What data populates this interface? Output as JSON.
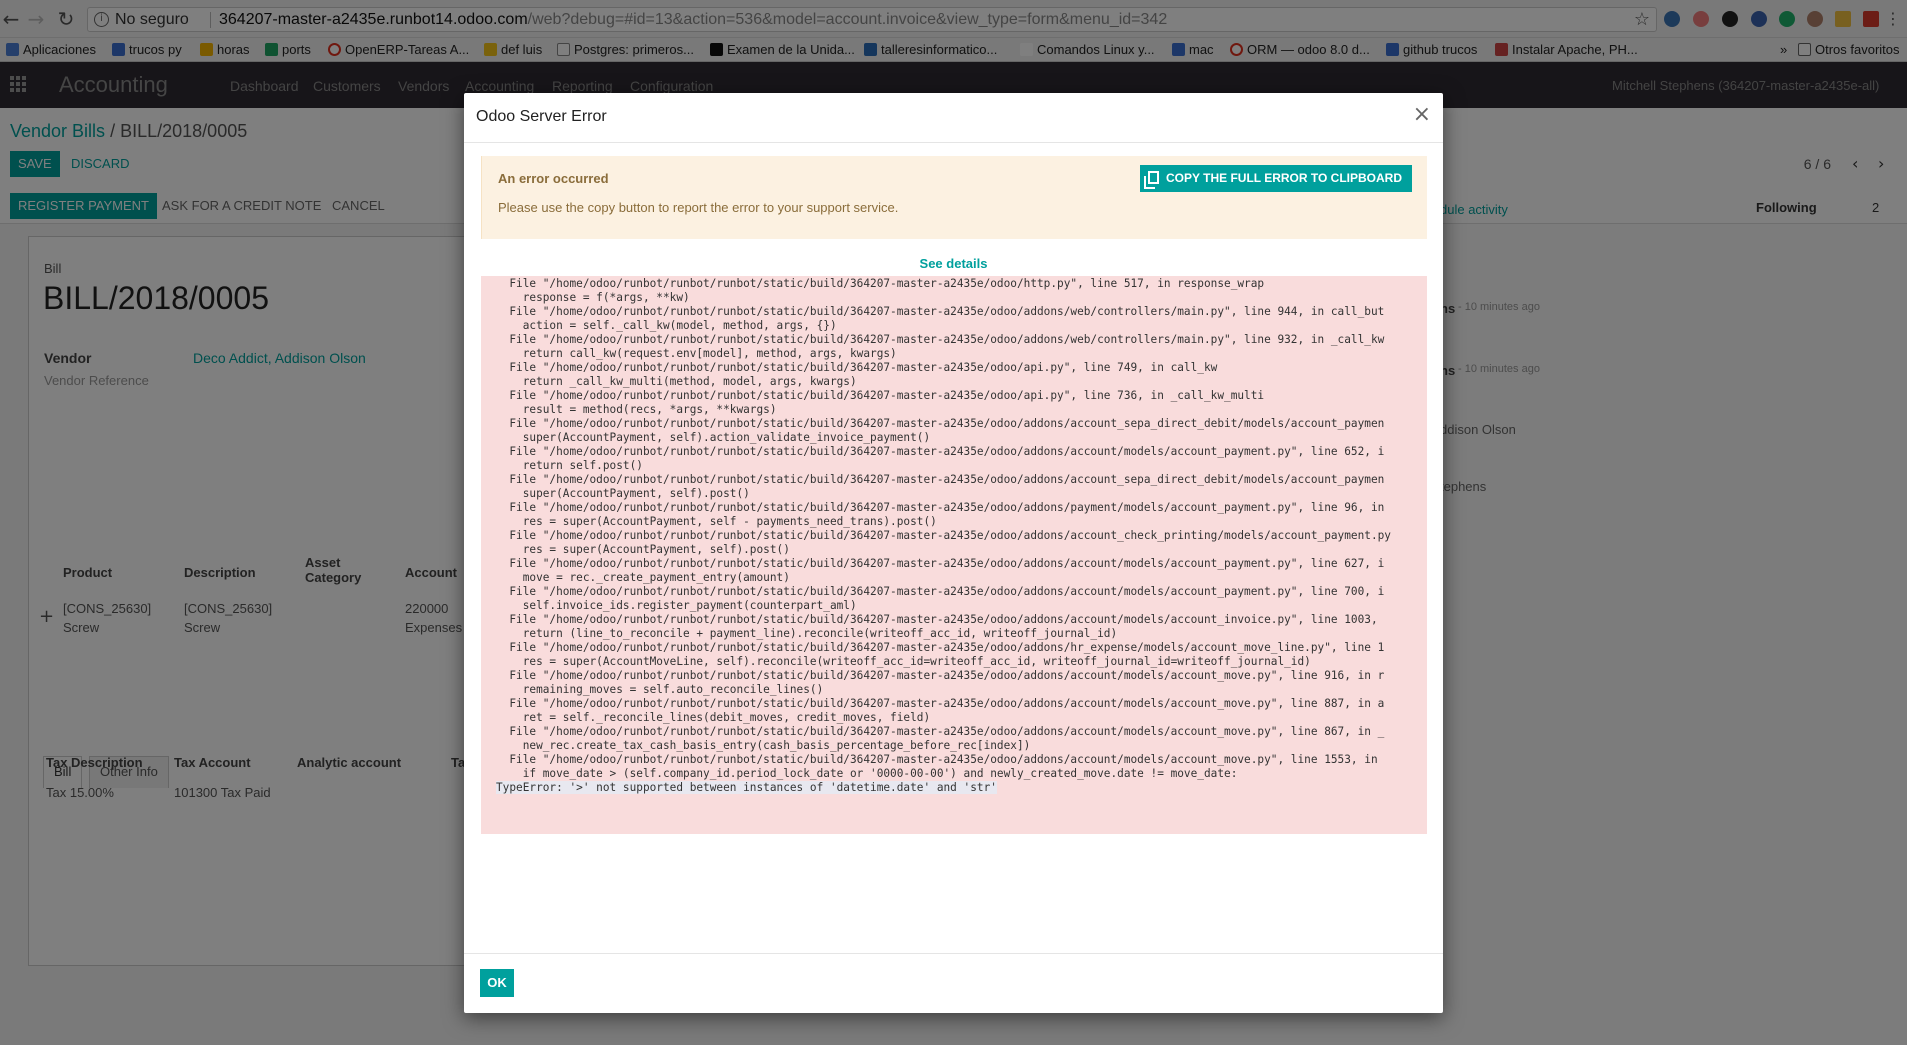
{
  "browser": {
    "security_label": "No seguro",
    "url_host": "364207-master-a2435e.runbot14.odoo.com",
    "url_path": "/web?debug=#id=13&action=536&model=account.invoice&view_type=form&menu_id=342",
    "bookmarks": [
      "Aplicaciones",
      "trucos py",
      "horas",
      "ports",
      "OpenERP-Tareas A...",
      "def luis",
      "Postgres: primeros...",
      "Examen de la Unida...",
      "talleresinformatico...",
      "Comandos Linux y...",
      "mac",
      "ORM — odoo 8.0 d...",
      "github trucos",
      "Instalar Apache, PH..."
    ],
    "bookmarks_more": "»",
    "other_bookmarks": "Otros favoritos"
  },
  "topnav": {
    "app_title": "Accounting",
    "menu": [
      "Dashboard",
      "Customers",
      "Vendors",
      "Accounting",
      "Reporting",
      "Configuration"
    ],
    "user": "Mitchell Stephens (364207-master-a2435e-all)"
  },
  "control": {
    "breadcrumb_parent": "Vendor Bills",
    "breadcrumb_sep": "/",
    "breadcrumb_current": "BILL/2018/0005",
    "save": "SAVE",
    "discard": "DISCARD",
    "pager": "6 / 6",
    "register_payment": "REGISTER PAYMENT",
    "credit_note": "ASK FOR A CREDIT NOTE",
    "cancel": "CANCEL",
    "schedule_activity": "dule activity",
    "following": "Following",
    "followers": "2"
  },
  "form": {
    "doc_type": "Bill",
    "name": "BILL/2018/0005",
    "vendor_label": "Vendor",
    "vendor_value": "Deco Addict, Addison Olson",
    "vendor_ref_label": "Vendor Reference",
    "tabs": [
      "Bill",
      "Other Info"
    ],
    "line_headers": [
      "Product",
      "Description",
      "Asset Category",
      "Account"
    ],
    "line": {
      "product": "[CONS_25630] Screw",
      "description": "[CONS_25630] Screw",
      "account": "220000 Expenses"
    },
    "tax_headers": [
      "Tax Description",
      "Tax Account",
      "Analytic account",
      "Ta"
    ],
    "tax_row": {
      "description": "Tax 15.00%",
      "account": "101300 Tax Paid"
    }
  },
  "chatter": {
    "time1": "- 10 minutes ago",
    "time2": "- 10 minutes ago",
    "partial1": "ns",
    "partial2": "ns",
    "partial3": "ddison Olson",
    "partial4": "tephens"
  },
  "dialog": {
    "title": "Odoo Server Error",
    "close": "×",
    "alert_title": "An error occurred",
    "alert_text": "Please use the copy button to report the error to your support service.",
    "copy_button": "COPY THE FULL ERROR TO CLIPBOARD",
    "see_details": "See details",
    "traceback": [
      "  File \"/home/odoo/runbot/runbot/runbot/static/build/364207-master-a2435e/odoo/http.py\", line 517, in response_wrap",
      "    response = f(*args, **kw)",
      "  File \"/home/odoo/runbot/runbot/runbot/static/build/364207-master-a2435e/odoo/addons/web/controllers/main.py\", line 944, in call_but",
      "    action = self._call_kw(model, method, args, {})",
      "  File \"/home/odoo/runbot/runbot/runbot/static/build/364207-master-a2435e/odoo/addons/web/controllers/main.py\", line 932, in _call_kw",
      "    return call_kw(request.env[model], method, args, kwargs)",
      "  File \"/home/odoo/runbot/runbot/runbot/static/build/364207-master-a2435e/odoo/api.py\", line 749, in call_kw",
      "    return _call_kw_multi(method, model, args, kwargs)",
      "  File \"/home/odoo/runbot/runbot/runbot/static/build/364207-master-a2435e/odoo/api.py\", line 736, in _call_kw_multi",
      "    result = method(recs, *args, **kwargs)",
      "  File \"/home/odoo/runbot/runbot/runbot/static/build/364207-master-a2435e/odoo/addons/account_sepa_direct_debit/models/account_paymen",
      "    super(AccountPayment, self).action_validate_invoice_payment()",
      "  File \"/home/odoo/runbot/runbot/runbot/static/build/364207-master-a2435e/odoo/addons/account/models/account_payment.py\", line 652, i",
      "    return self.post()",
      "  File \"/home/odoo/runbot/runbot/runbot/static/build/364207-master-a2435e/odoo/addons/account_sepa_direct_debit/models/account_paymen",
      "    super(AccountPayment, self).post()",
      "  File \"/home/odoo/runbot/runbot/runbot/static/build/364207-master-a2435e/odoo/addons/payment/models/account_payment.py\", line 96, in",
      "    res = super(AccountPayment, self - payments_need_trans).post()",
      "  File \"/home/odoo/runbot/runbot/runbot/static/build/364207-master-a2435e/odoo/addons/account_check_printing/models/account_payment.py",
      "    res = super(AccountPayment, self).post()",
      "  File \"/home/odoo/runbot/runbot/runbot/static/build/364207-master-a2435e/odoo/addons/account/models/account_payment.py\", line 627, i",
      "    move = rec._create_payment_entry(amount)",
      "  File \"/home/odoo/runbot/runbot/runbot/static/build/364207-master-a2435e/odoo/addons/account/models/account_payment.py\", line 700, i",
      "    self.invoice_ids.register_payment(counterpart_aml)",
      "  File \"/home/odoo/runbot/runbot/runbot/static/build/364207-master-a2435e/odoo/addons/account/models/account_invoice.py\", line 1003,",
      "    return (line_to_reconcile + payment_line).reconcile(writeoff_acc_id, writeoff_journal_id)",
      "  File \"/home/odoo/runbot/runbot/runbot/static/build/364207-master-a2435e/odoo/addons/hr_expense/models/account_move_line.py\", line 1",
      "    res = super(AccountMoveLine, self).reconcile(writeoff_acc_id=writeoff_acc_id, writeoff_journal_id=writeoff_journal_id)",
      "  File \"/home/odoo/runbot/runbot/runbot/static/build/364207-master-a2435e/odoo/addons/account/models/account_move.py\", line 916, in r",
      "    remaining_moves = self.auto_reconcile_lines()",
      "  File \"/home/odoo/runbot/runbot/runbot/static/build/364207-master-a2435e/odoo/addons/account/models/account_move.py\", line 887, in a",
      "    ret = self._reconcile_lines(debit_moves, credit_moves, field)",
      "  File \"/home/odoo/runbot/runbot/runbot/static/build/364207-master-a2435e/odoo/addons/account/models/account_move.py\", line 867, in _",
      "    new_rec.create_tax_cash_basis_entry(cash_basis_percentage_before_rec[index])",
      "  File \"/home/odoo/runbot/runbot/runbot/static/build/364207-master-a2435e/odoo/addons/account/models/account_move.py\", line 1553, in",
      "    if move_date > (self.company_id.period_lock_date or '0000-00-00') and newly_created_move.date != move_date:",
      "TypeError: '>' not supported between instances of 'datetime.date' and 'str'"
    ],
    "ok": "OK"
  },
  "colors": {
    "brand": "#00a09d",
    "navbar": "#2f2a33",
    "alert_bg": "#fcf1e1",
    "trace_bg": "#f9dcdc"
  },
  "icons": {
    "back": "arrow-left-icon",
    "forward": "arrow-right-icon",
    "reload": "reload-icon",
    "info": "info-icon",
    "star": "star-icon",
    "apps": "apps-grid-icon",
    "close": "close-icon",
    "copy": "clipboard-icon",
    "add_line": "plus-icon"
  }
}
